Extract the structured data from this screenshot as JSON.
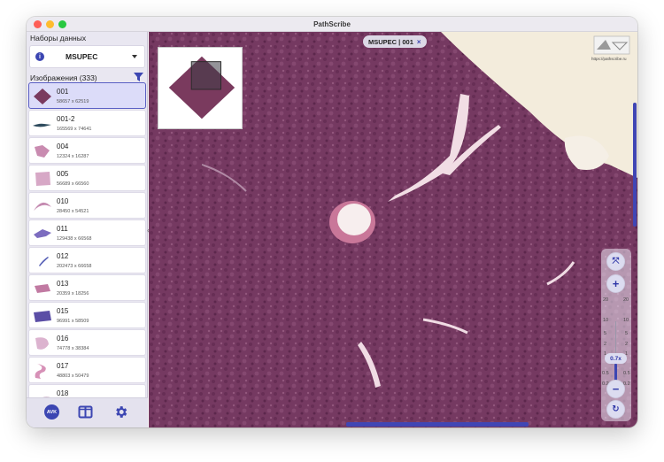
{
  "window": {
    "title": "PathScribe"
  },
  "sidebar": {
    "datasets_header": "Наборы данных",
    "dataset": {
      "name": "MSUPEC"
    },
    "images_header": "Изображения (333)",
    "images": [
      {
        "name": "001",
        "dims": "58657 x 62519",
        "selected": true
      },
      {
        "name": "001-2",
        "dims": "165569 x 74641"
      },
      {
        "name": "004",
        "dims": "12324 x 16287"
      },
      {
        "name": "005",
        "dims": "56689 x 66560"
      },
      {
        "name": "010",
        "dims": "28450 x 54521"
      },
      {
        "name": "011",
        "dims": "129438 x 66568"
      },
      {
        "name": "012",
        "dims": "202473 x 66658"
      },
      {
        "name": "013",
        "dims": "20359 x 18256"
      },
      {
        "name": "015",
        "dims": "96991 x 58509"
      },
      {
        "name": "016",
        "dims": "74778 x 38384"
      },
      {
        "name": "017",
        "dims": "48803 x 50479"
      },
      {
        "name": "018",
        "dims": ""
      }
    ],
    "bottom": {
      "avk_label": "AVK"
    }
  },
  "viewer": {
    "tag": {
      "label": "MSUPEC | 001",
      "close": "×"
    },
    "logo": {
      "url": "https://pathscribe.ru"
    },
    "zoom": {
      "fit": "⤧",
      "plus": "+",
      "minus": "−",
      "reset": "↻",
      "labels_left": [
        "20",
        "10",
        "5",
        "2",
        "1",
        "0.5",
        "0.2"
      ],
      "labels_right": [
        "20",
        "10",
        "5",
        "2",
        "1",
        "0.5",
        "0.2"
      ],
      "value": "0.7x"
    }
  },
  "colors": {
    "accent": "#3c46b2",
    "tissue": "#7a3a5e",
    "background_slide": "#f3ecdc"
  }
}
